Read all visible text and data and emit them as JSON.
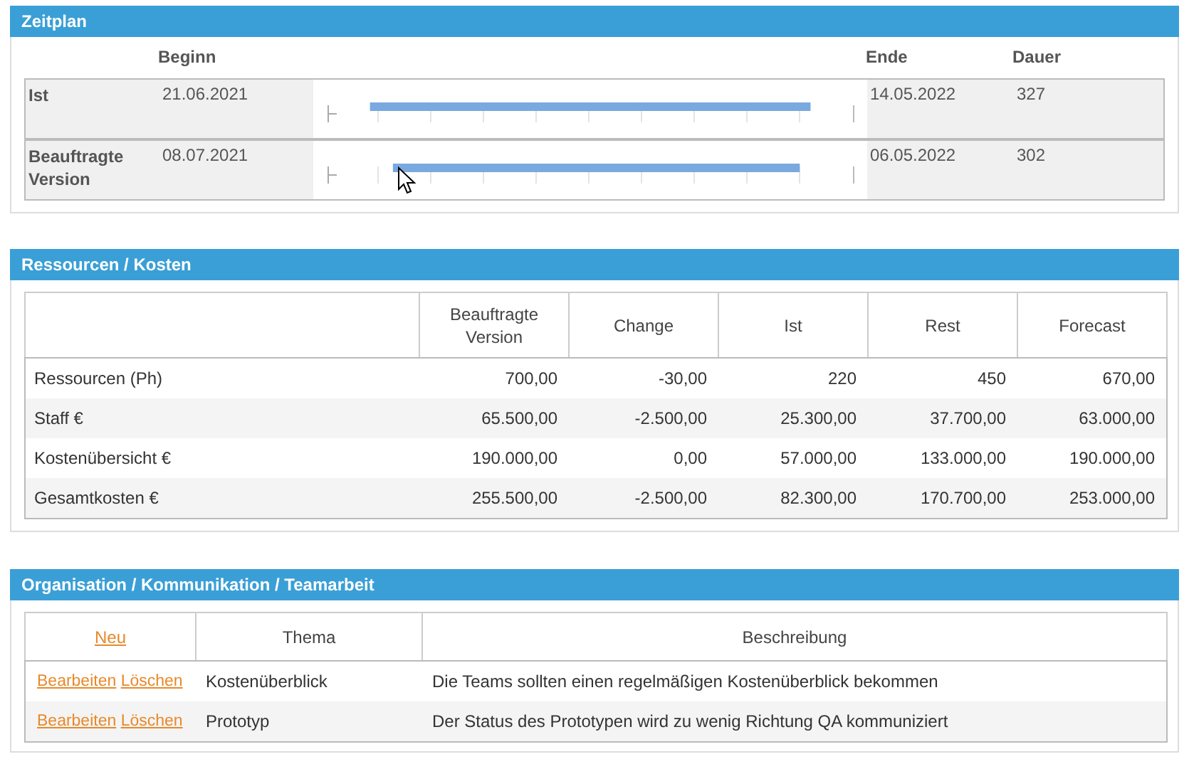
{
  "zeitplan": {
    "title": "Zeitplan",
    "columns": [
      "Beginn",
      "Ende",
      "Dauer"
    ],
    "rows": [
      {
        "label": "Ist",
        "begin": "21.06.2021",
        "end": "14.05.2022",
        "duration": "327"
      },
      {
        "label": "Beauftragte Version",
        "begin": "08.07.2021",
        "end": "06.05.2022",
        "duration": "302"
      }
    ]
  },
  "ressourcen": {
    "title": "Ressourcen / Kosten",
    "columns": [
      "Beauftragte Version",
      "Change",
      "Ist",
      "Rest",
      "Forecast"
    ],
    "rows": [
      {
        "label": "Ressourcen (Ph)",
        "values": [
          "700,00",
          "-30,00",
          "220",
          "450",
          "670,00"
        ]
      },
      {
        "label": "Staff €",
        "values": [
          "65.500,00",
          "-2.500,00",
          "25.300,00",
          "37.700,00",
          "63.000,00"
        ]
      },
      {
        "label": "Kostenübersicht €",
        "values": [
          "190.000,00",
          "0,00",
          "57.000,00",
          "133.000,00",
          "190.000,00"
        ]
      },
      {
        "label": "Gesamtkosten €",
        "values": [
          "255.500,00",
          "-2.500,00",
          "82.300,00",
          "170.700,00",
          "253.000,00"
        ]
      }
    ]
  },
  "organisation": {
    "title": "Organisation / Kommunikation / Teamarbeit",
    "new_link": "Neu",
    "columns": [
      "Thema",
      "Beschreibung"
    ],
    "rows": [
      {
        "edit": "Bearbeiten",
        "delete": "Löschen",
        "topic": "Kostenüberblick",
        "description": "Die Teams sollten einen regelmäßigen Kostenüberblick bekommen"
      },
      {
        "edit": "Bearbeiten",
        "delete": "Löschen",
        "topic": "Prototyp",
        "description": "Der Status des Prototypen wird zu wenig Richtung QA kommuniziert"
      }
    ]
  }
}
